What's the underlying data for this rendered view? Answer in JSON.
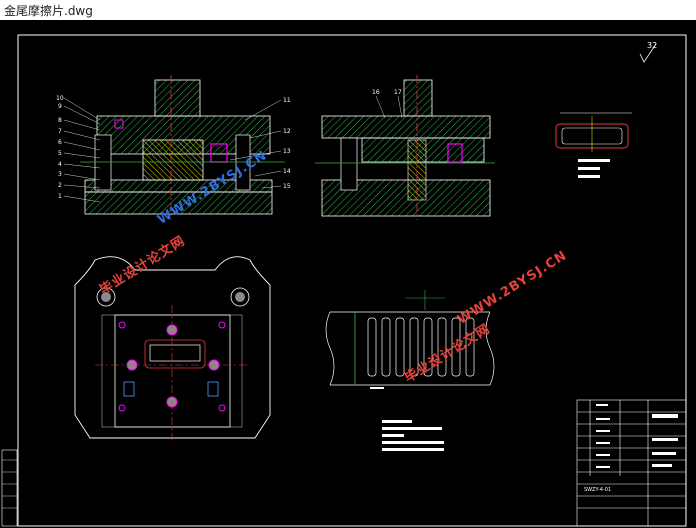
{
  "window": {
    "title": "金尾摩擦片.dwg"
  },
  "drawing": {
    "roughness": "32",
    "balloons_left": [
      "10",
      "9",
      "8",
      "7",
      "6",
      "5",
      "4",
      "3",
      "2",
      "1"
    ],
    "balloons_right": [
      "11",
      "12",
      "13",
      "14",
      "15"
    ],
    "balloons_mid": [
      "16",
      "17"
    ],
    "block_label": "SWZY-4-01",
    "watermarks": {
      "site1": "WWW.2BYSJ.CN",
      "cn1": "毕业设计论文网",
      "site2": "WWW.2BYSJ.CN",
      "cn2": "毕业设计论文网"
    }
  },
  "colors": {
    "background": "#000000",
    "frame": "#ffffff",
    "hatch": "#2fb84a",
    "centerline": "#e83a3a",
    "accent": "#ffff00",
    "tool": "#ff00ff"
  }
}
